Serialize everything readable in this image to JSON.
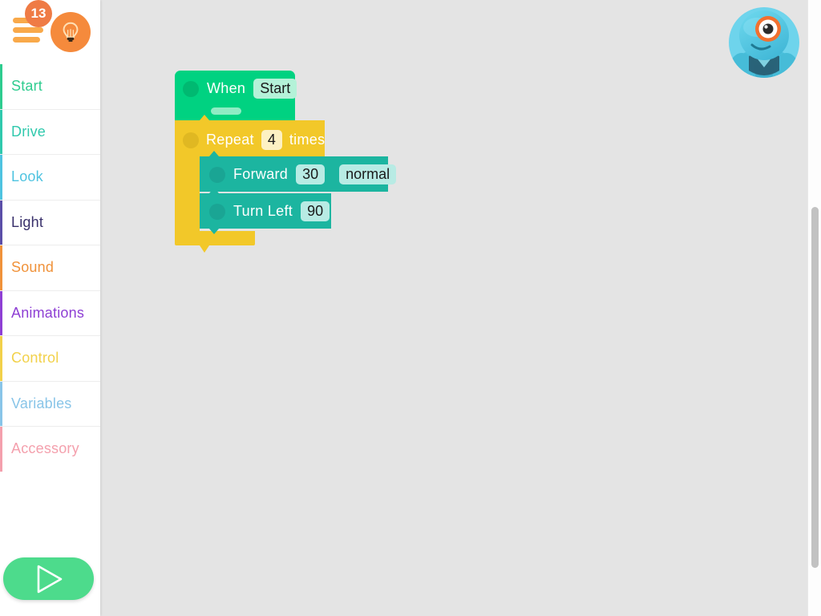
{
  "app": {
    "name": "Blockly Robot Programming Workspace",
    "workspace_background": "#e4e4e4"
  },
  "sidebar": {
    "menu_icon": "hamburger-menu-icon",
    "badge_count": "13",
    "badge_color": "#ef7b45",
    "hint_icon": "lightbulb-icon",
    "hint_button_color": "#f58a3c",
    "items": [
      {
        "label": "Start",
        "color": "#2ecc8f",
        "stripe": "#2ecc8f"
      },
      {
        "label": "Drive",
        "color": "#30c9ad",
        "stripe": "#30c9ad"
      },
      {
        "label": "Look",
        "color": "#4ec3e0",
        "stripe": "#4ec3e0"
      },
      {
        "label": "Light",
        "color": "#39306b",
        "stripe": "#5b4ea8"
      },
      {
        "label": "Sound",
        "color": "#f0923a",
        "stripe": "#f0923a"
      },
      {
        "label": "Animations",
        "color": "#8e3fd4",
        "stripe": "#8e3fd4"
      },
      {
        "label": "Control",
        "color": "#f2d14a",
        "stripe": "#f2d14a"
      },
      {
        "label": "Variables",
        "color": "#89c5e8",
        "stripe": "#89c5e8"
      },
      {
        "label": "Accessory",
        "color": "#f4a0ad",
        "stripe": "#f4a0ad"
      }
    ],
    "play_button": {
      "icon": "play-triangle-icon",
      "color": "#4ddb8c"
    }
  },
  "workspace": {
    "robot_avatar": {
      "icon": "dash-robot-avatar",
      "body_color": "#4ec9e8",
      "eye_ring_color": "#f26a3d"
    },
    "scrollbar": {
      "thumb_color": "#c2c2c2"
    },
    "blocks": [
      {
        "id": "when-start",
        "type": "event",
        "label": "When",
        "field_value": "Start",
        "color": "#00d281",
        "field_color": "#b4f2d8"
      },
      {
        "id": "repeat",
        "type": "loop",
        "label_prefix": "Repeat",
        "field_value": "4",
        "label_suffix": "times",
        "color": "#f2c829",
        "field_color": "#fdf1c3"
      },
      {
        "id": "forward",
        "type": "drive",
        "label": "Forward",
        "field_distance": "30",
        "field_speed": "normal",
        "color": "#1cb5a0",
        "field_color": "#b8ebe4"
      },
      {
        "id": "turn-left",
        "type": "drive",
        "label": "Turn Left",
        "field_angle": "90",
        "color": "#1cb5a0",
        "field_color": "#b8ebe4"
      }
    ]
  }
}
